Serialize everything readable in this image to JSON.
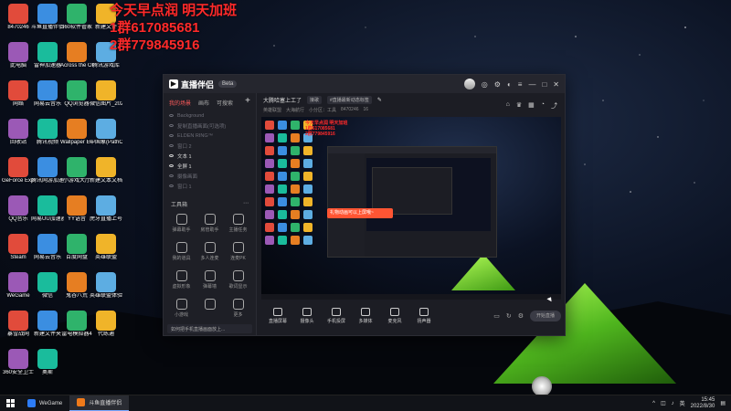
{
  "promo": {
    "line1": "今天早点润 明天加班",
    "line2": "1群617085681",
    "line3": "2群779845916"
  },
  "desktop_icons": [
    {
      "label": "8470246"
    },
    {
      "label": "斗鱼直播伴侣"
    },
    {
      "label": "360软件管家"
    },
    {
      "label": "新建文件"
    },
    {
      "label": "此电脑"
    },
    {
      "label": "雷神加速器"
    },
    {
      "label": "Across the Obelisk"
    },
    {
      "label": "腾讯游戏库"
    },
    {
      "label": "网络"
    },
    {
      "label": "网易云音乐"
    },
    {
      "label": "QQ浏览器"
    },
    {
      "label": "微信图片_2022081..."
    },
    {
      "label": "回收站"
    },
    {
      "label": "腾讯视频"
    },
    {
      "label": "Wallpaper Engine..."
    },
    {
      "label": "中国象(PathOfN..."
    },
    {
      "label": "GeForce Experience"
    },
    {
      "label": "腾讯网游加速器"
    },
    {
      "label": "小游戏大厅"
    },
    {
      "label": "新建文本文档"
    },
    {
      "label": "QQ音乐"
    },
    {
      "label": "网易UU加速器"
    },
    {
      "label": "YY语音"
    },
    {
      "label": "虎牙直播上号器"
    },
    {
      "label": "Steam"
    },
    {
      "label": "网易云音乐"
    },
    {
      "label": "百度网盘"
    },
    {
      "label": "英雄联盟"
    },
    {
      "label": "WeGame"
    },
    {
      "label": "微信"
    },
    {
      "label": "鬼谷八荒"
    },
    {
      "label": "英雄联盟体验服"
    },
    {
      "label": "暴雪战网"
    },
    {
      "label": "新建文件夹"
    },
    {
      "label": "雷电模拟器4"
    },
    {
      "label": "代练通"
    },
    {
      "label": "360安全卫士"
    },
    {
      "label": "奥斯"
    }
  ],
  "app": {
    "title": "直播伴侣",
    "badge": "Beta",
    "tabs": [
      "我的场景",
      "画布",
      "可搜索"
    ],
    "scenes": [
      {
        "label": "Background",
        "on": false
      },
      {
        "label": "复制直播画面(可选项)",
        "on": false
      },
      {
        "label": "ELDEN RING™",
        "on": false
      },
      {
        "label": "窗口 2",
        "on": false
      },
      {
        "label": "文本 1",
        "on": true
      },
      {
        "label": "全屏 1",
        "on": true
      },
      {
        "label": "摄像画面",
        "on": false
      },
      {
        "label": "窗口 1",
        "on": false
      }
    ],
    "tools_title": "工具箱",
    "tools": [
      "弹幕助手",
      "房管助手",
      "主播任务",
      "我的道具",
      "多人连麦",
      "连麦PK",
      "虚拟形象",
      "弹幕墙",
      "歌词显示",
      "小游戏",
      "",
      "更多"
    ],
    "tip": "如何把手机直播画面放上...",
    "stream_title": "大腾哈塞上工了",
    "stream_chip1": "接歌",
    "stream_chip2": "#直播最新动态标签",
    "sub": [
      "英雄联盟",
      "大海航行",
      "小分区：工具",
      "8470246",
      "16"
    ],
    "controls": [
      "直播屏幕",
      "摄像头",
      "手机投屏",
      "多媒体",
      "麦克风",
      "扬声器"
    ],
    "live_button": "开始直播",
    "preview_promo": [
      "今天早点润 明天加班",
      "1群617085681",
      "2群779845916"
    ],
    "preview_toast": "礼物动画可以上屏哦~"
  },
  "taskbar": {
    "tasks": [
      {
        "label": "WeGame",
        "active": false
      },
      {
        "label": "斗鱼直播伴侣",
        "active": true
      }
    ],
    "time": "15:45",
    "date": "2022/8/30",
    "ime": "英"
  }
}
